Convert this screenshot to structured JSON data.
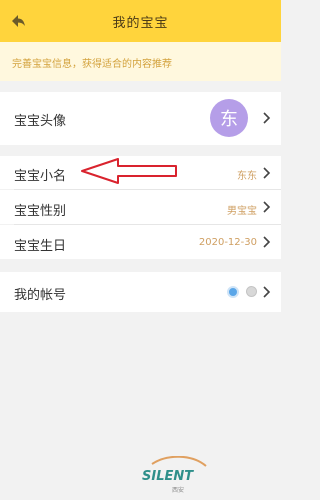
{
  "header": {
    "title": "我的宝宝"
  },
  "notice": {
    "text": "完善宝宝信息，获得适合的内容推荐"
  },
  "profile": {
    "avatar_label": "宝宝头像",
    "avatar_text": "东",
    "nickname_label": "宝宝小名",
    "nickname_value": "东东",
    "gender_label": "宝宝性别",
    "gender_value": "男宝宝",
    "birthday_label": "宝宝生日",
    "birthday_value": "2020-12-30"
  },
  "account": {
    "label": "我的帐号"
  },
  "watermark": {
    "brand": "SILENT",
    "sub": "西安"
  },
  "colors": {
    "header_bg": "#ffd43c",
    "accent_value": "#cf9f62",
    "annotation_red": "#d9232e"
  }
}
